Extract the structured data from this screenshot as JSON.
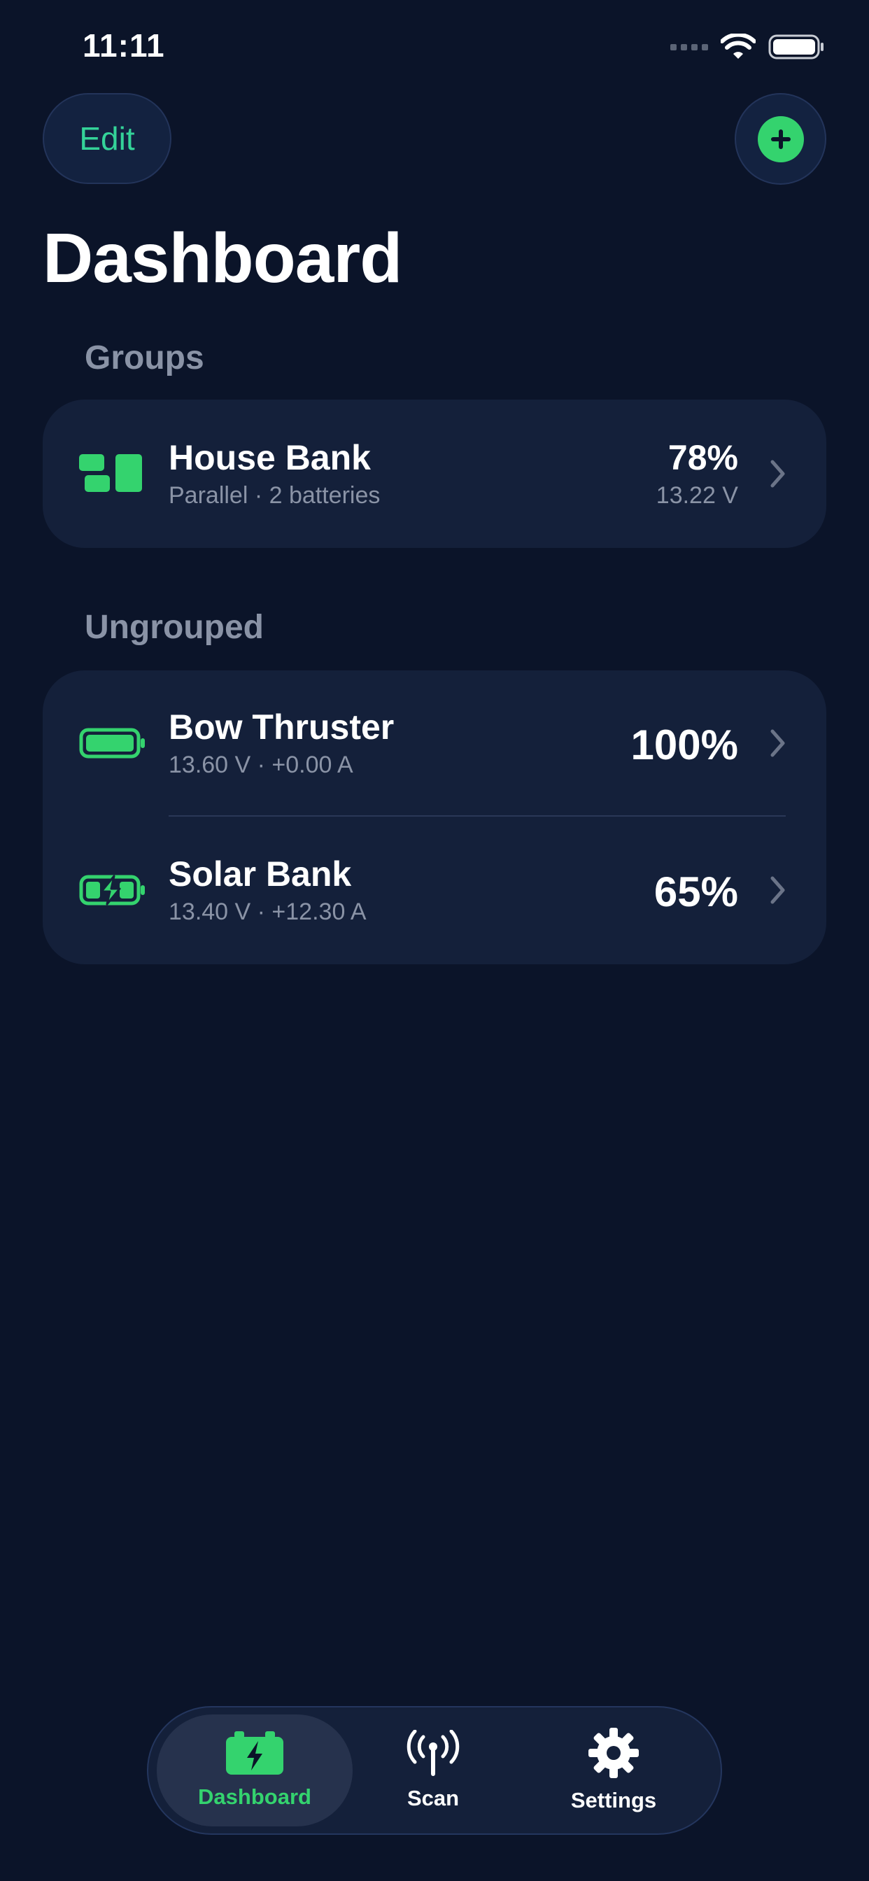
{
  "status_bar": {
    "time": "11:11"
  },
  "header": {
    "edit_label": "Edit",
    "title": "Dashboard"
  },
  "groups": {
    "label": "Groups",
    "items": [
      {
        "name": "House Bank",
        "detail": "Parallel · 2 batteries",
        "percent": "78%",
        "voltage": "13.22 V"
      }
    ]
  },
  "ungrouped": {
    "label": "Ungrouped",
    "items": [
      {
        "name": "Bow Thruster",
        "detail": "13.60 V · +0.00 A",
        "percent": "100%",
        "icon": "battery-full-icon"
      },
      {
        "name": "Solar Bank",
        "detail": "13.40 V · +12.30 A",
        "percent": "65%",
        "icon": "battery-charging-icon"
      }
    ]
  },
  "tabbar": {
    "tabs": [
      {
        "label": "Dashboard",
        "icon": "battery-bolt-icon",
        "active": true
      },
      {
        "label": "Scan",
        "icon": "antenna-icon",
        "active": false
      },
      {
        "label": "Settings",
        "icon": "gear-icon",
        "active": false
      }
    ]
  },
  "colors": {
    "background": "#0b1429",
    "card": "#14203a",
    "accent": "#34d36e",
    "muted": "#8a93a6"
  }
}
